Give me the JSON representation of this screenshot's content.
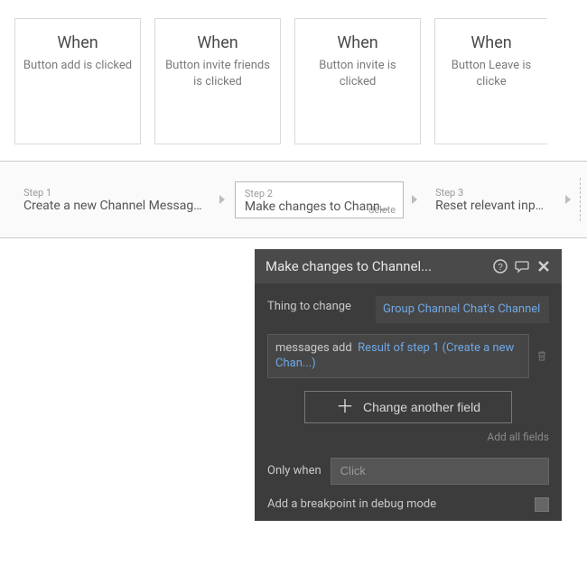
{
  "events": [
    {
      "title": "When",
      "desc": "Button add is clicked"
    },
    {
      "title": "When",
      "desc": "Button invite friends is clicked"
    },
    {
      "title": "When",
      "desc": "Button invite is clicked"
    },
    {
      "title": "When",
      "desc": "Button Leave is clicke"
    }
  ],
  "workflow": {
    "steps": [
      {
        "label": "Step 1",
        "title": "Create a new Channel Message..."
      },
      {
        "label": "Step 2",
        "title": "Make changes to Channel...",
        "delete": "delete"
      },
      {
        "label": "Step 3",
        "title": "Reset relevant inputs"
      }
    ]
  },
  "panel": {
    "title": "Make changes to Channel...",
    "thing_to_change_label": "Thing to change",
    "thing_to_change_value": "Group Channel Chat's Channel",
    "field_action": "messages add",
    "field_value": "Result of step 1 (Create a new Chan...)",
    "change_another_label": "Change another field",
    "add_all_label": "Add all fields",
    "only_when_label": "Only when",
    "only_when_placeholder": "Click",
    "breakpoint_label": "Add a breakpoint in debug mode"
  }
}
